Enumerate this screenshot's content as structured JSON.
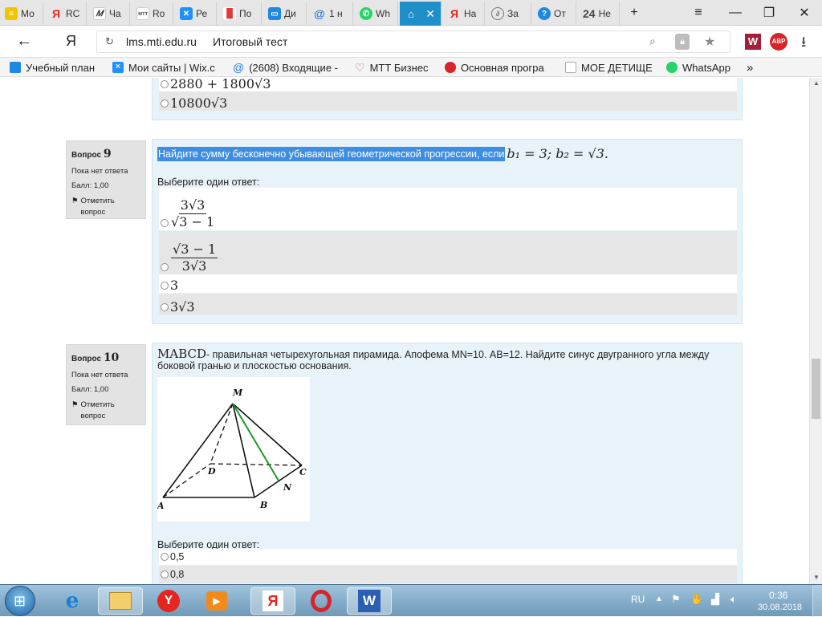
{
  "tabs": [
    {
      "label": "Мо",
      "icon": "notes-icon",
      "color": "#f2c400"
    },
    {
      "label": "RC",
      "icon": "yandex-icon",
      "color": "#e52620"
    },
    {
      "label": "Ча",
      "icon": "mtt-icon",
      "color": "#555555"
    },
    {
      "label": "Ro",
      "icon": "mtt-logo-icon",
      "color": "#777777"
    },
    {
      "label": "Ре",
      "icon": "wix-icon",
      "color": "#1e90ff"
    },
    {
      "label": "По",
      "icon": "chart-icon",
      "color": "#e53935"
    },
    {
      "label": "Ди",
      "icon": "chat-icon",
      "color": "#1e88e5"
    },
    {
      "label": "1 н",
      "icon": "mail-icon",
      "color": "#2b7bd6"
    },
    {
      "label": "Wh",
      "icon": "whatsapp-icon",
      "color": "#25d366"
    },
    {
      "label": "",
      "icon": "moodle-icon",
      "color": "#ffffff"
    },
    {
      "label": "На",
      "icon": "yandex-icon",
      "color": "#e52620"
    },
    {
      "label": "За",
      "icon": "answers-icon",
      "color": "#777777"
    },
    {
      "label": "От",
      "icon": "question-icon",
      "color": "#1e88e5"
    },
    {
      "label": "Не",
      "icon": "number-24-icon",
      "color": "#444444"
    }
  ],
  "tab_24_text": "24",
  "address": {
    "domain": "lms.mti.edu.ru",
    "title": "Итоговый тест"
  },
  "bookmarks": [
    {
      "label": "Учебный план",
      "icon": "moodle-icon"
    },
    {
      "label": "Мои сайты | Wix.c",
      "icon": "wix-icon"
    },
    {
      "label": "(2608) Входящие -",
      "icon": "mail-icon"
    },
    {
      "label": "МТТ Бизнес",
      "icon": "heart-icon"
    },
    {
      "label": "Основная програ",
      "icon": "opera-icon"
    },
    {
      "label": "МОЕ ДЕТИЩЕ",
      "icon": "mtt-logo-icon"
    },
    {
      "label": "WhatsApp",
      "icon": "whatsapp-icon"
    }
  ],
  "bookmarks_more": "»",
  "prev_options": [
    "2880 + 1800√3",
    "10800√3"
  ],
  "q9": {
    "label": "Вопрос",
    "number": "9",
    "status": "Пока нет ответа",
    "score": "Балл: 1,00",
    "flag": "Отметить вопрос",
    "text": "Найдите сумму бесконечно убывающей геометрической прогрессии, если",
    "formula": "b₁ = 3; b₂ = √3.",
    "choose": "Выберите один ответ:",
    "options": {
      "a_num": "3√3",
      "a_den": "√3 − 1",
      "b_num": "√3 − 1",
      "b_den": "3√3",
      "c": "3",
      "d": "3√3"
    }
  },
  "q10": {
    "label": "Вопрос",
    "number": "10",
    "status": "Пока нет ответа",
    "score": "Балл: 1,00",
    "flag": "Отметить вопрос",
    "formula": "MABCD",
    "text": "- правильная четырехугольная пирамида. Апофема MN=10. АВ=12. Найдите синус двугранного угла между боковой гранью и плоскостью основания.",
    "diagram_labels": {
      "M": "M",
      "A": "A",
      "B": "B",
      "C": "C",
      "D": "D",
      "N": "N"
    },
    "choose": "Выберите один ответ:",
    "options": [
      "0,5",
      "0,8"
    ]
  },
  "taskbar": {
    "lang": "RU",
    "time": "0:36",
    "date": "30.08.2018"
  },
  "colors": {
    "tab_active": "#1e8fc9",
    "selection": "#3d8ee0",
    "question_bg": "#e7f3f9",
    "apothem": "#1a9a2a"
  }
}
